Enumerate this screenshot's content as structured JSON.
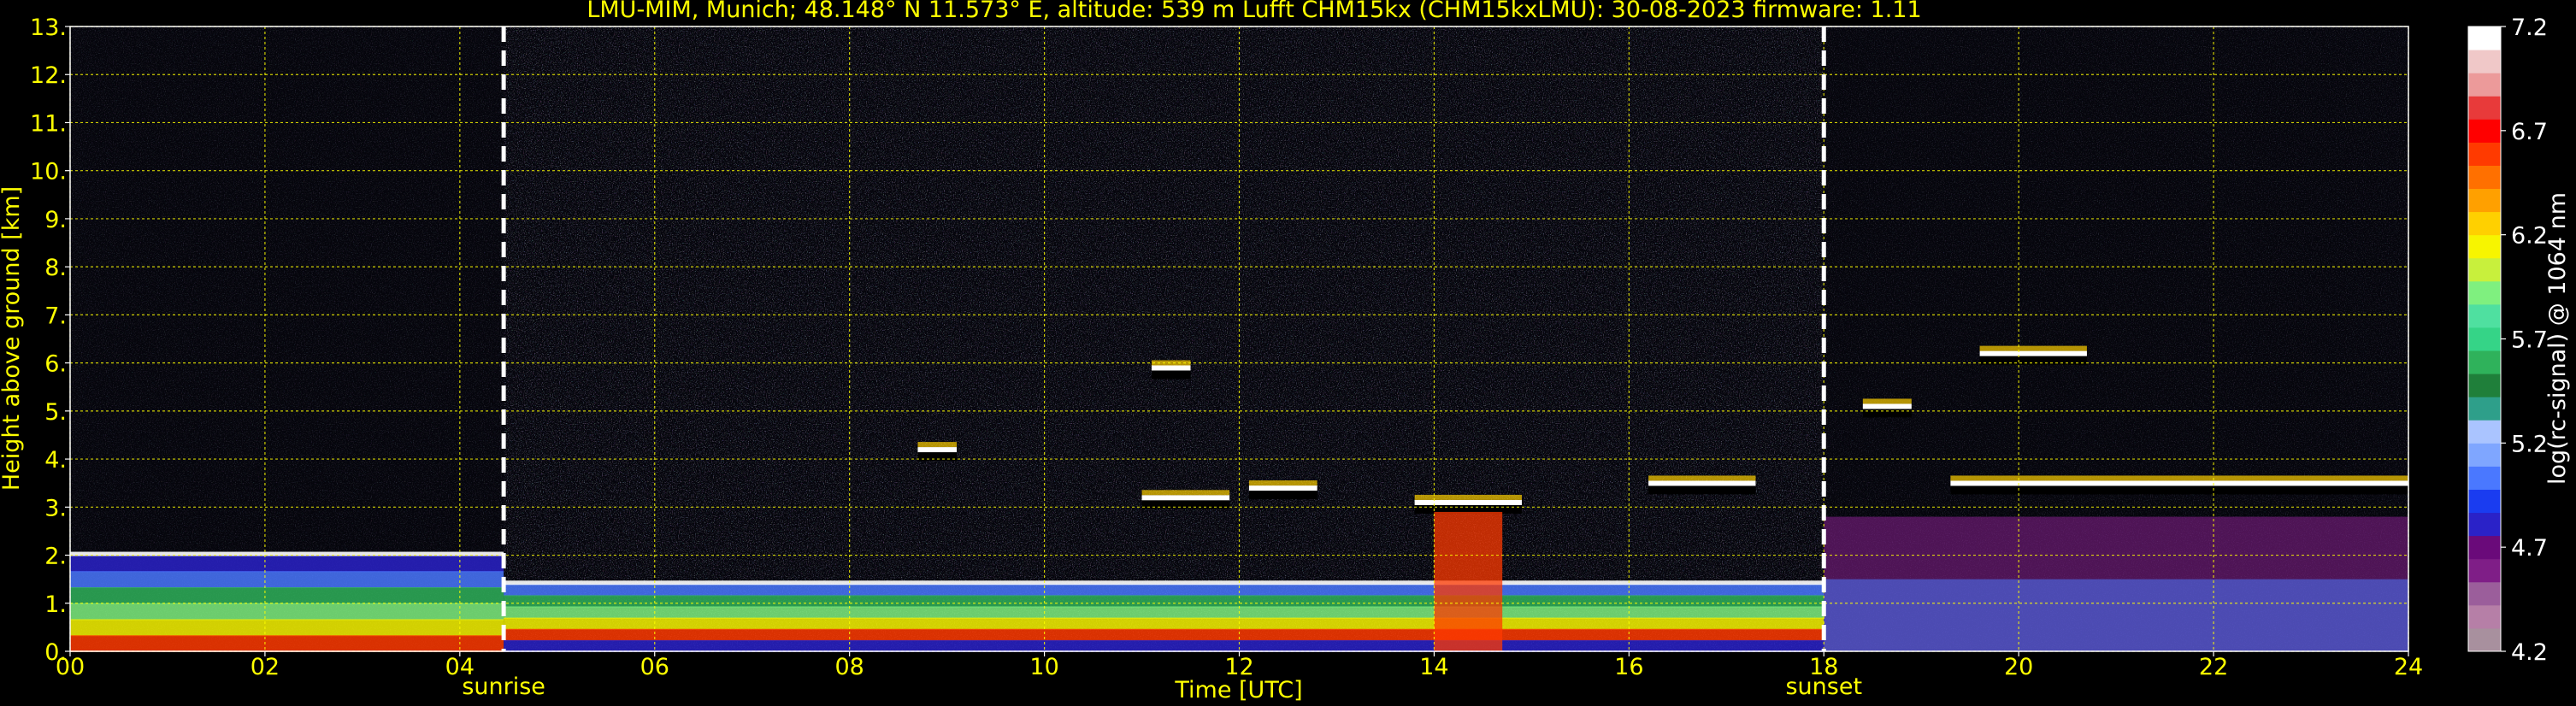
{
  "chart_data": {
    "type": "heatmap",
    "title": "LMU-MIM, Munich; 48.148° N 11.573° E, altitude: 539 m    Lufft CHM15kx (CHM15kxLMU): 30-08-2023    firmware: 1.11",
    "xlabel": "Time [UTC]",
    "ylabel": "Height above ground [km]",
    "xlim": [
      0,
      24
    ],
    "ylim": [
      0,
      13
    ],
    "x_ticks": [
      0,
      2,
      4,
      6,
      8,
      10,
      12,
      14,
      16,
      18,
      20,
      22,
      24
    ],
    "x_tick_labels": [
      "00",
      "02",
      "04",
      "06",
      "08",
      "10",
      "12",
      "14",
      "16",
      "18",
      "20",
      "22",
      "24"
    ],
    "y_ticks": [
      0,
      1,
      2,
      3,
      4,
      5,
      6,
      7,
      8,
      9,
      10,
      11,
      12,
      13
    ],
    "y_tick_labels": [
      "0.",
      "1.",
      "2.",
      "3.",
      "4.",
      "5.",
      "6.",
      "7.",
      "8.",
      "9.",
      "10.",
      "11.",
      "12.",
      "13."
    ],
    "grid": true,
    "markers": [
      {
        "label": "sunrise",
        "time_utc": 4.45
      },
      {
        "label": "sunset",
        "time_utc": 18.0
      }
    ],
    "colorbar": {
      "label": "log(rc-signal) @ 1064 nm",
      "range": [
        4.2,
        7.2
      ],
      "tick_values": [
        4.2,
        4.7,
        5.2,
        5.7,
        6.2,
        6.7,
        7.2
      ],
      "tick_labels": [
        "4.2",
        "4.7",
        "5.2",
        "5.7",
        "6.2",
        "6.7",
        "7.2"
      ],
      "colors": [
        "#a8909e",
        "#b67fa7",
        "#9b5e9b",
        "#7f1e87",
        "#6a0a7a",
        "#2a22c8",
        "#1a3cf0",
        "#4a78ff",
        "#7fa6ff",
        "#aac4ff",
        "#2e9f8a",
        "#1f7f3a",
        "#2fb25b",
        "#35d487",
        "#4fe0a0",
        "#7ff07f",
        "#c8f03c",
        "#f7f500",
        "#ffd000",
        "#ffa000",
        "#ff7000",
        "#ff3a00",
        "#ff0000",
        "#e83a3a",
        "#ec9a9a",
        "#f0c8c8",
        "#ffffff"
      ]
    },
    "features": [
      {
        "kind": "boundary layer",
        "start_utc": 0.0,
        "end_utc": 4.45,
        "height_km": 2.0
      },
      {
        "kind": "boundary layer",
        "start_utc": 4.45,
        "end_utc": 18.0,
        "height_km": 1.4
      },
      {
        "kind": "cloud layer",
        "start_utc": 8.7,
        "end_utc": 9.1,
        "height_km": 4.0
      },
      {
        "kind": "cloud layer",
        "start_utc": 11.1,
        "end_utc": 11.5,
        "height_km": 5.7
      },
      {
        "kind": "cloud layer",
        "start_utc": 11.0,
        "end_utc": 11.9,
        "height_km": 3.0
      },
      {
        "kind": "cloud layer",
        "start_utc": 12.1,
        "end_utc": 12.8,
        "height_km": 3.2
      },
      {
        "kind": "cloud layer",
        "start_utc": 13.8,
        "end_utc": 14.9,
        "height_km": 2.9
      },
      {
        "kind": "cloud layer",
        "start_utc": 16.2,
        "end_utc": 17.3,
        "height_km": 3.3
      },
      {
        "kind": "cloud layer",
        "start_utc": 18.4,
        "end_utc": 18.9,
        "height_km": 4.9
      },
      {
        "kind": "cloud layer",
        "start_utc": 19.3,
        "end_utc": 24.0,
        "height_km": 3.3
      },
      {
        "kind": "cloud layer",
        "start_utc": 19.6,
        "end_utc": 20.7,
        "height_km": 6.0
      }
    ]
  }
}
